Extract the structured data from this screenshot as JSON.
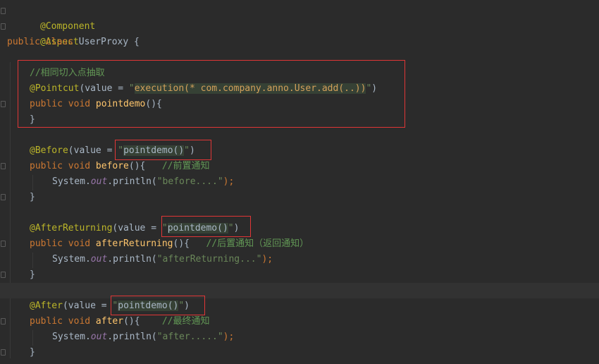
{
  "editor": {
    "lines": {
      "l1": {
        "ann": "@Component"
      },
      "l2": {
        "ann": "@Aspect"
      },
      "l3": {
        "kw": "public class ",
        "name": "UserProxy",
        "rest": " {"
      },
      "l5": {
        "cmt": "//相同切入点抽取"
      },
      "l6": {
        "ann": "@Pointcut",
        "p1": "(value = ",
        "q1": "\"",
        "inj": "execution(* com.company.anno.User.add(..))",
        "q2": "\"",
        "p2": ")"
      },
      "l7": {
        "kw": "public void ",
        "fn": "pointdemo",
        "rest": "(){"
      },
      "l8": {
        "rest": "}"
      },
      "l10": {
        "ann": "@Before",
        "p1": "(value = ",
        "q1": "\"",
        "inj": "pointdemo()",
        "q2": "\"",
        "p2": ")"
      },
      "l11": {
        "kw": "public void ",
        "fn": "before",
        "rest": "(){   ",
        "cmt": "//前置通知"
      },
      "l12": {
        "cls": "System.",
        "field": "out",
        "mid": ".println(",
        "str": "\"before....\"",
        "end": ");"
      },
      "l13": {
        "rest": "}"
      },
      "l15": {
        "ann": "@AfterReturning",
        "p1": "(value = ",
        "q1": "\"",
        "inj": "pointdemo()",
        "q2": "\"",
        "p2": ")"
      },
      "l16": {
        "kw": "public void ",
        "fn": "afterReturning",
        "rest": "(){   ",
        "cmt": "//后置通知（返回通知）"
      },
      "l17": {
        "cls": "System.",
        "field": "out",
        "mid": ".println(",
        "str": "\"afterReturning...\"",
        "end": ");"
      },
      "l18": {
        "rest": "}"
      },
      "l20": {
        "ann": "@After",
        "p1": "(value = ",
        "q1": "\"",
        "inj": "pointdemo()",
        "q2": "\"",
        "p2": ")"
      },
      "l21": {
        "kw": "public void ",
        "fn": "after",
        "rest": "(){    ",
        "cmt": "//最终通知"
      },
      "l22": {
        "cls": "System.",
        "field": "out",
        "mid": ".println(",
        "str": "\"after.....\"",
        "end": ");"
      },
      "l23": {
        "rest": "}"
      }
    }
  },
  "colors": {
    "background": "#2b2b2b",
    "annotation": "#bbb529",
    "keyword": "#cc7832",
    "method": "#ffc66d",
    "string": "#6a8759",
    "comment": "#629755",
    "field": "#9876aa",
    "highlight_box": "#e03636"
  }
}
